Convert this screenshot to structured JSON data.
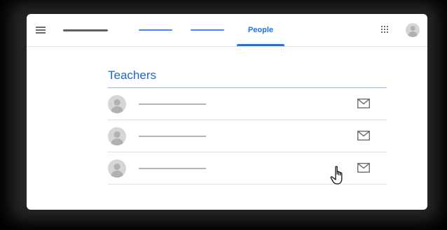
{
  "header": {
    "active_tab": "People",
    "icons": {
      "menu": "hamburger-menu-icon",
      "apps": "apps-grid-icon",
      "account": "account-avatar-icon"
    }
  },
  "teachers": {
    "title": "Teachers",
    "rows": [
      {
        "avatar": "person-avatar-icon",
        "action": "email-icon"
      },
      {
        "avatar": "person-avatar-icon",
        "action": "email-icon"
      },
      {
        "avatar": "person-avatar-icon",
        "action": "email-icon"
      }
    ]
  },
  "cursor": "pointer-hand-icon",
  "colors": {
    "accent": "#1a73e8",
    "tab_placeholder": "#4285f4",
    "section_rule": "#8fb5ec"
  }
}
